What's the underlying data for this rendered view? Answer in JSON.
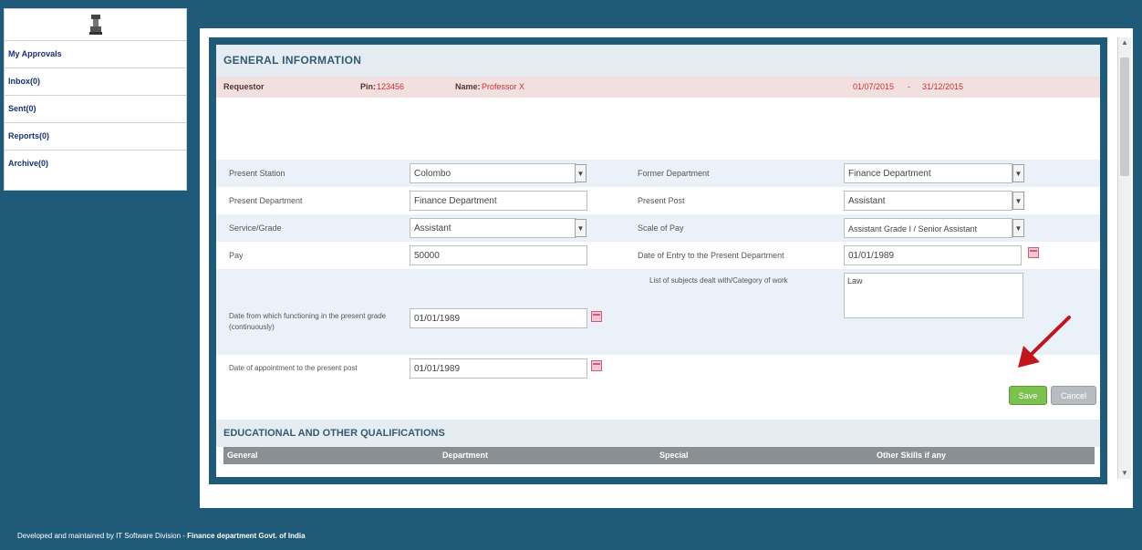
{
  "sidebar": {
    "items": [
      {
        "label": "My Approvals"
      },
      {
        "label": "Inbox(0)"
      },
      {
        "label": "Sent(0)"
      },
      {
        "label": "Reports(0)"
      },
      {
        "label": "Archive(0)"
      }
    ]
  },
  "general": {
    "title": "GENERAL INFORMATION",
    "info_bar": {
      "label": "Requestor",
      "pin_label": "Pin:",
      "pin_value": "123456",
      "name_label": "Name:",
      "name_value": "Professor X",
      "date_from": "01/07/2015",
      "date_to": "31/12/2015"
    },
    "fields": {
      "present_station_label": "Present Station",
      "present_station_value": "Colombo",
      "present_department_label": "Present Department",
      "present_department_value": "Finance Department",
      "service_label": "Service/Grade",
      "service_value": "Assistant",
      "pay_label": "Pay",
      "pay_value": "50000",
      "date_commencing_label": "Date from which functioning in the present grade (continuously)",
      "date_commencing_value": "01/01/1989",
      "date_appointment_label": "Date of appointment to the present post",
      "date_appointment_value": "01/01/1989",
      "former_department_label": "Former Department",
      "former_department_value": "Finance Department",
      "present_post_label": "Present Post",
      "present_post_value": "Assistant",
      "scale_label": "Scale of Pay",
      "scale_value": "Assistant Grade I / Senior Assistant",
      "date_entry_label": "Date of Entry to the Present Department",
      "date_entry_value": "01/01/1989",
      "subjects_label": "List of subjects dealt with/Category of work",
      "subjects_value": "Law"
    },
    "save_label": "Save",
    "cancel_label": "Cancel"
  },
  "education": {
    "title": "EDUCATIONAL AND OTHER QUALIFICATIONS",
    "columns": [
      "General",
      "Department",
      "Special",
      "Other Skills if any"
    ]
  },
  "footer": {
    "text": "Developed and maintained by IT Software Division - ",
    "bold": "Finance department Govt. of India"
  },
  "colors": {
    "page_bg": "#1f5a78",
    "save_button": "#7cc04e",
    "pointer_arrow": "#c0161c",
    "info_bar_bg": "#f2e0e0"
  }
}
